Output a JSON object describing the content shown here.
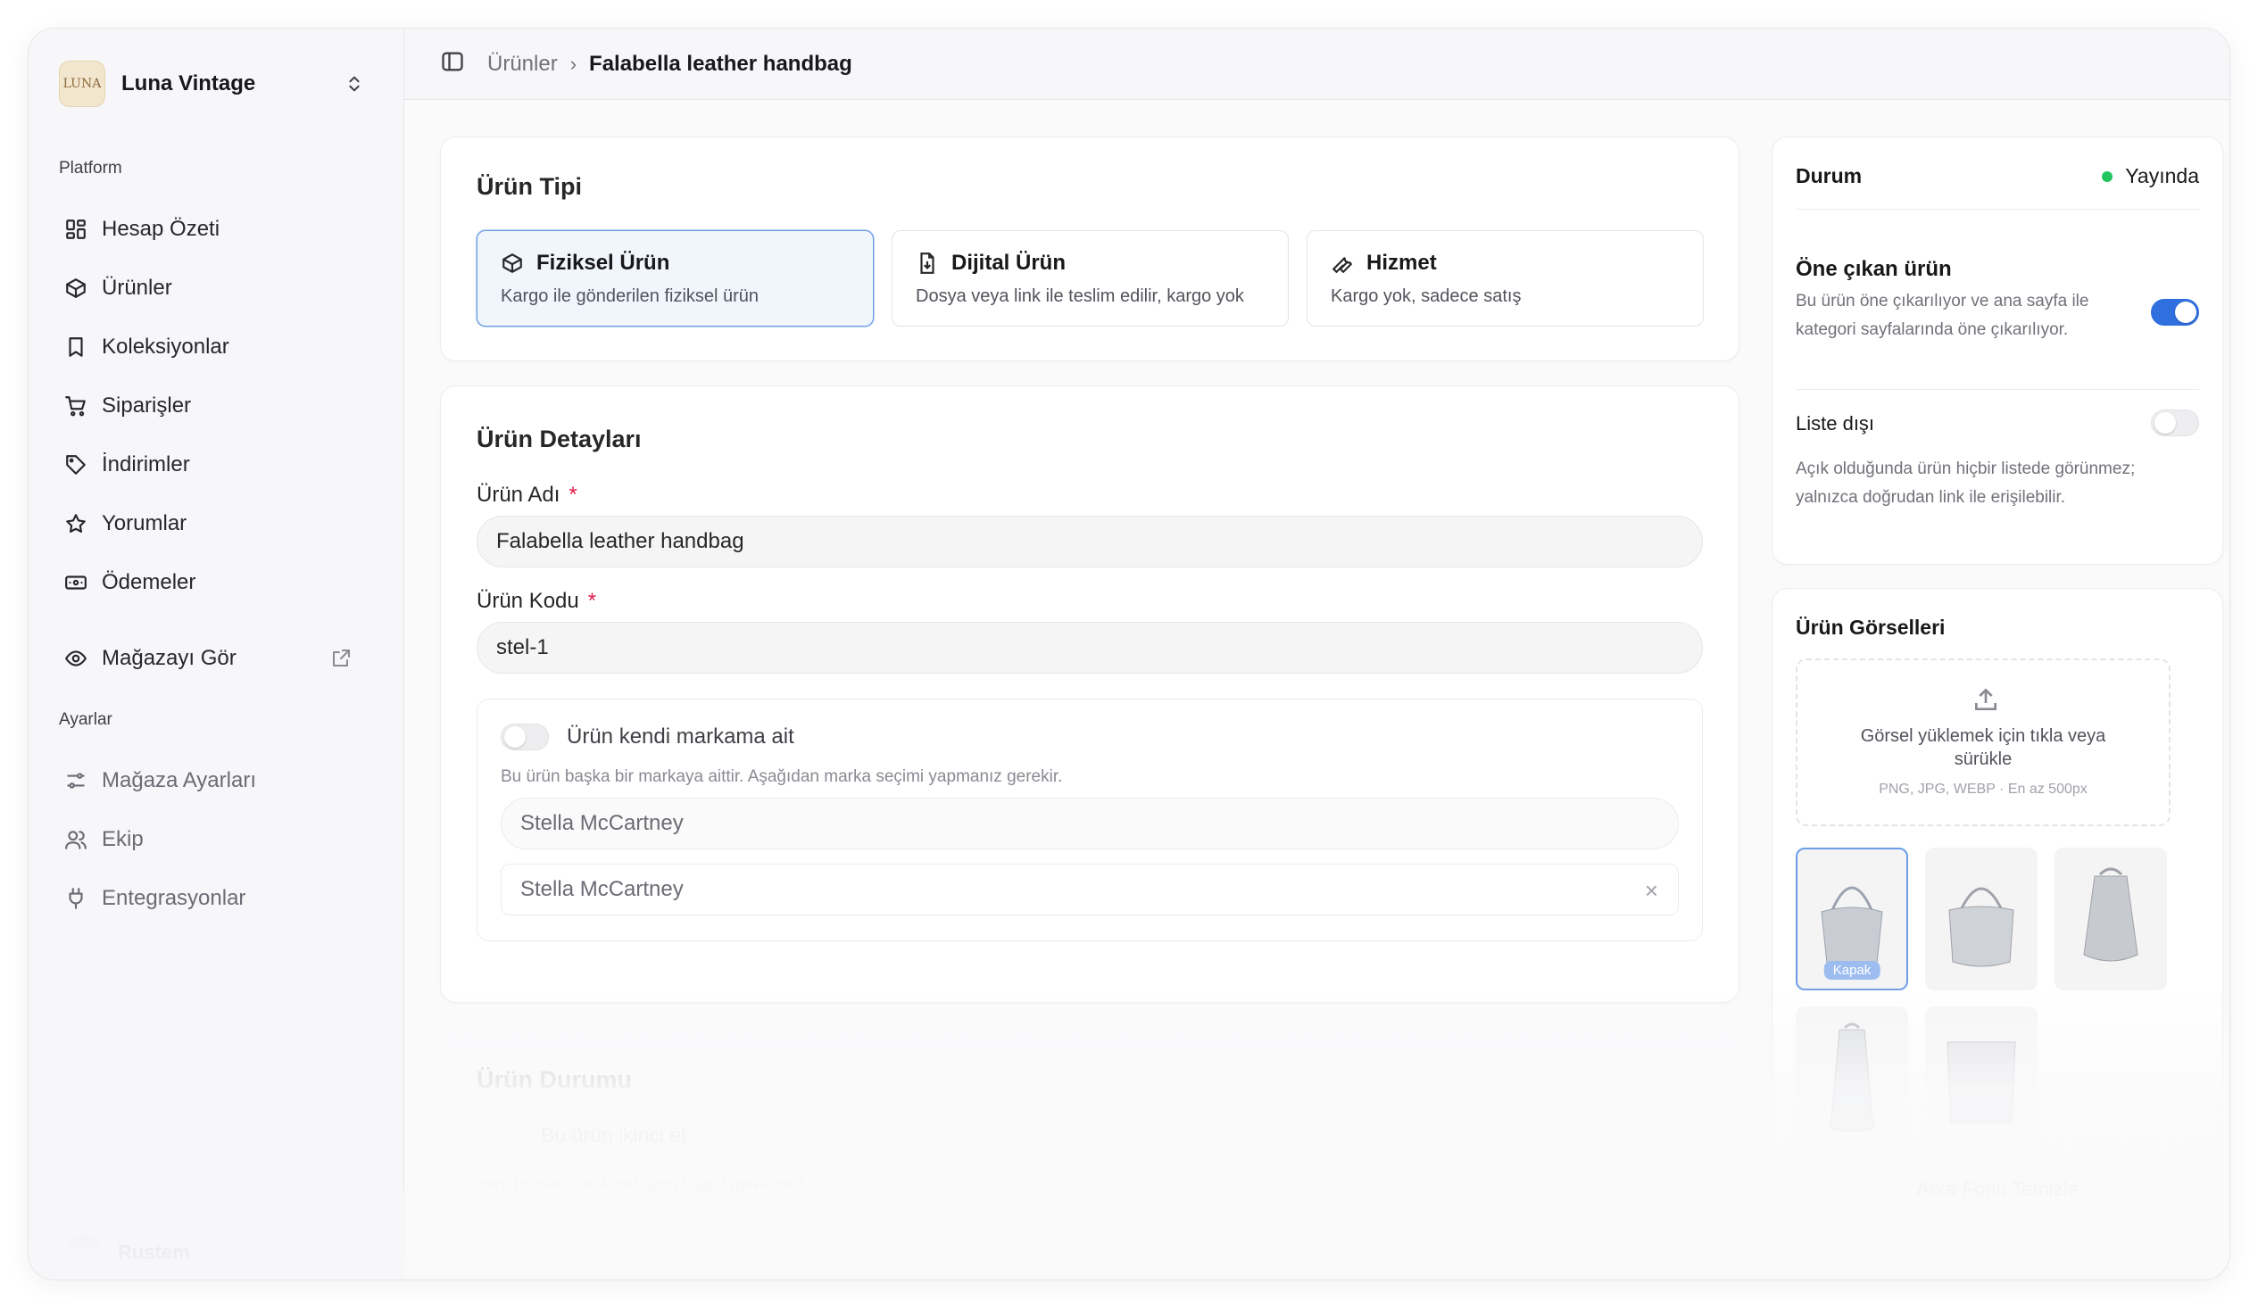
{
  "sidebar": {
    "brand": {
      "name": "Luna Vintage",
      "logo_text": "LUNA"
    },
    "platform_label": "Platform",
    "items": [
      {
        "label": "Hesap Özeti",
        "icon": "dashboard-icon"
      },
      {
        "label": "Ürünler",
        "icon": "package-icon"
      },
      {
        "label": "Koleksiyonlar",
        "icon": "bookmark-icon"
      },
      {
        "label": "Siparişler",
        "icon": "cart-icon"
      },
      {
        "label": "İndirimler",
        "icon": "tag-icon"
      },
      {
        "label": "Yorumlar",
        "icon": "star-icon"
      },
      {
        "label": "Ödemeler",
        "icon": "banknote-icon"
      }
    ],
    "view_store": {
      "label": "Mağazayı Gör",
      "icon": "eye-icon"
    },
    "settings_label": "Ayarlar",
    "settings_items": [
      {
        "label": "Mağaza Ayarları",
        "icon": "sliders-icon"
      },
      {
        "label": "Ekip",
        "icon": "users-icon"
      },
      {
        "label": "Entegrasyonlar",
        "icon": "plug-icon"
      }
    ],
    "user": {
      "name": "Rustem"
    }
  },
  "header": {
    "breadcrumb_parent": "Ürünler",
    "breadcrumb_current": "Falabella leather handbag"
  },
  "product_type": {
    "title": "Ürün Tipi",
    "options": [
      {
        "title": "Fiziksel Ürün",
        "desc": "Kargo ile gönderilen fiziksel ürün",
        "selected": true
      },
      {
        "title": "Dijital Ürün",
        "desc": "Dosya veya link ile teslim edilir, kargo yok",
        "selected": false
      },
      {
        "title": "Hizmet",
        "desc": "Kargo yok, sadece satış",
        "selected": false
      }
    ]
  },
  "details": {
    "title": "Ürün Detayları",
    "name_label": "Ürün Adı",
    "name_value": "Falabella leather handbag",
    "code_label": "Ürün Kodu",
    "code_value": "stel-1",
    "required_mark": "*",
    "own_brand_label": "Ürün kendi markama ait",
    "own_brand_on": false,
    "brand_hint": "Bu ürün başka bir markaya aittir. Aşağıdan marka seçimi yapmanız gerekir.",
    "brand_search_value": "Stella McCartney",
    "brand_selected": "Stella McCartney"
  },
  "condition": {
    "title": "Ürün Durumu",
    "second_hand_label": "Bu ürün ikinci el",
    "hint": "Yeni ürünler için kondisyon bilgisi gerekmez."
  },
  "status": {
    "title": "Durum",
    "value": "Yayında",
    "dot_color": "#22c55e",
    "featured_title": "Öne çıkan ürün",
    "featured_desc": "Bu ürün öne çıkarılıyor ve ana sayfa ile kategori sayfalarında öne çıkarılıyor.",
    "featured_on": true,
    "unlisted_title": "Liste dışı",
    "unlisted_on": false,
    "unlisted_desc": "Açık olduğunda ürün hiçbir listede görünmez; yalnızca doğrudan link ile erişilebilir."
  },
  "images": {
    "title": "Ürün Görselleri",
    "upload_text": "Görsel yüklemek için tıkla veya sürükle",
    "upload_hint": "PNG, JPG, WEBP · En az 500px",
    "cover_label": "Kapak",
    "remove_bg_label": "Arka Fonu Temizle"
  },
  "accent": "#2f6fde"
}
